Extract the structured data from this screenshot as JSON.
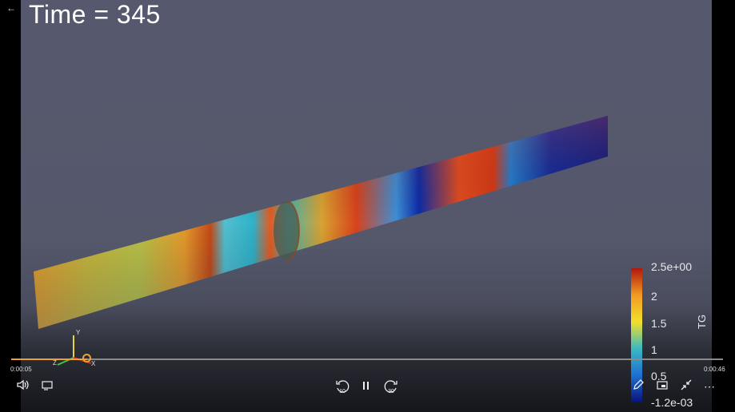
{
  "overlay": {
    "time_label": "Time = 345"
  },
  "colorbar": {
    "title": "TG",
    "ticks": [
      "2.5e+00",
      "2",
      "1.5",
      "1",
      "0.5",
      "-1.2e-03"
    ],
    "colors": [
      "#08127a",
      "#1e6fd0",
      "#3bb8c4",
      "#f2e02a",
      "#f29a23",
      "#b0170c"
    ]
  },
  "axes_triad": {
    "y": "Y",
    "z": "Z",
    "x": "X"
  },
  "player": {
    "current_time": "0:00:05",
    "duration": "0:00:46",
    "progress": 0.107,
    "rewind_label": "10",
    "forward_label": "30",
    "icons": {
      "back": "back-arrow-icon",
      "volume": "volume-icon",
      "captions": "captions-icon",
      "rewind": "rewind-10-icon",
      "pause": "pause-icon",
      "forward": "forward-30-icon",
      "edit": "pen-icon",
      "miniplayer": "miniplayer-icon",
      "fullscreen": "exit-fullscreen-icon",
      "more": "more-icon"
    },
    "accent_color": "#f0a030"
  }
}
